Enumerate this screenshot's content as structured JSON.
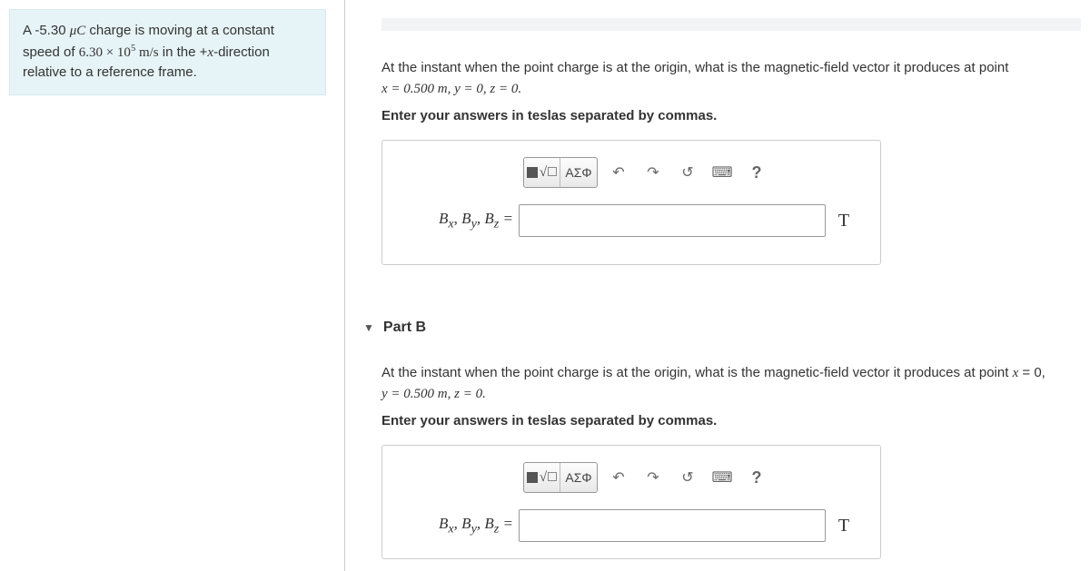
{
  "problem": {
    "line1_a": "A -5.30 ",
    "charge_units": "μC",
    "line1_b": " charge is moving at a constant speed of ",
    "speed_coeff": "6.30 × 10",
    "speed_exp": "5",
    "speed_units": " m/s",
    "line1_c": " in the +",
    "xvar": "x",
    "line1_d": "-direction relative to a reference frame."
  },
  "partA": {
    "prompt_a": "At the instant when the point charge is at the origin, what is the magnetic-field vector it produces at point ",
    "coords": "x = 0.500 m, y = 0, z = 0.",
    "instruct": "Enter your answers in teslas separated by commas.",
    "greek": "ΑΣΦ",
    "vec_label": "Bₓ, Bᵧ, B_z =",
    "unit": "T",
    "help": "?"
  },
  "partB": {
    "title": "Part B",
    "prompt_a": "At the instant when the point charge is at the origin, what is the magnetic-field vector it produces at point ",
    "coords": "x = 0, y = 0.500 m, z = 0.",
    "instruct": "Enter your answers in teslas separated by commas.",
    "greek": "ΑΣΦ",
    "vec_label": "Bₓ, Bᵧ, B_z =",
    "unit": "T",
    "help": "?"
  }
}
